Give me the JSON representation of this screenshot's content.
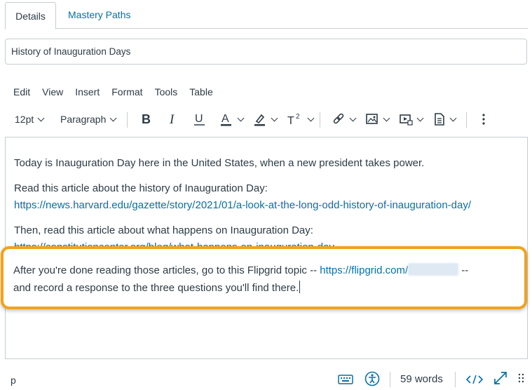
{
  "tabs": {
    "details": "Details",
    "mastery_paths": "Mastery Paths"
  },
  "title_input": {
    "value": "History of Inauguration Days"
  },
  "menu": [
    "Edit",
    "View",
    "Insert",
    "Format",
    "Tools",
    "Table"
  ],
  "toolbar": {
    "font_size": "12pt",
    "block_format": "Paragraph",
    "icons": [
      "bold-icon",
      "italic-icon",
      "underline-icon",
      "text-color-icon",
      "highlight-color-icon",
      "superscript-icon",
      "link-icon",
      "image-icon",
      "media-icon",
      "document-icon",
      "more-icon"
    ]
  },
  "editor": {
    "p1": "Today is Inauguration Day here in the United States, when a new president takes power.",
    "p2": "Read this article about the history of Inauguration Day:",
    "p2_link": "https://news.harvard.edu/gazette/story/2021/01/a-look-at-the-long-odd-history-of-inauguration-day/",
    "p3": "Then, read this article about what happens on Inauguration Day:",
    "p3_link_clipped": "https://constitutioncenter.org/blog/what-happens-on-inauguration-day"
  },
  "highlight": {
    "line1_prefix": "After you're done reading those articles, go to this Flipgrid topic -- ",
    "line1_link": "https://flipgrid.com/",
    "line1_suffix": " --",
    "line2": "and record a response to the three questions you'll find there.",
    "accent_color": "#f2a21b"
  },
  "statusbar": {
    "path": "p",
    "word_count": "59 words",
    "icons": [
      "keyboard-icon",
      "accessibility-icon",
      "html-editor-icon",
      "fullscreen-icon",
      "resize-handle-icon"
    ]
  },
  "colors": {
    "link": "#0770a3",
    "text": "#2d3b45",
    "border": "#c7cdd1"
  }
}
